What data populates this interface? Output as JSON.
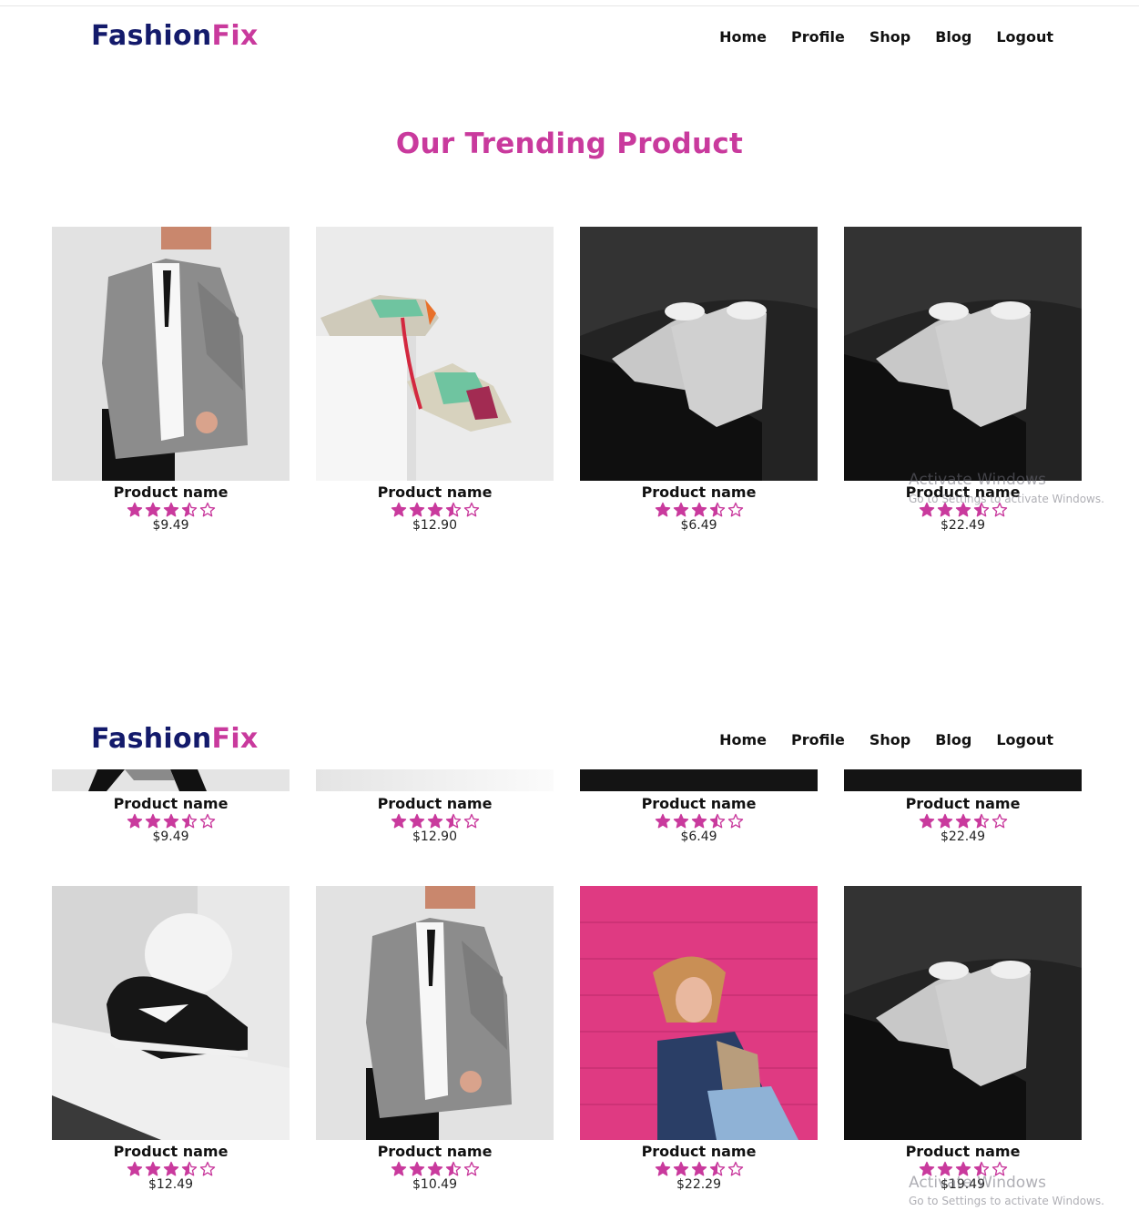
{
  "brand": {
    "part1": "Fashion",
    "part2": "Fix"
  },
  "nav": [
    "Home",
    "Profile",
    "Shop",
    "Blog",
    "Logout"
  ],
  "section_title": "Our Trending Product",
  "product_label": "Product name",
  "rating": 3.5,
  "colors": {
    "brand_navy": "#131a6b",
    "accent_pink": "#c93a9d"
  },
  "products_row1": [
    {
      "name": "Product name",
      "price": "$9.49",
      "image": "blazer-woman"
    },
    {
      "name": "Product name",
      "price": "$12.90",
      "image": "colorful-sneakers"
    },
    {
      "name": "Product name",
      "price": "$6.49",
      "image": "white-sneakers-dark"
    },
    {
      "name": "Product name",
      "price": "$22.49",
      "image": "white-sneakers-dark"
    }
  ],
  "products_row2": [
    {
      "name": "Product name",
      "price": "$12.49",
      "image": "black-nike-sneaker"
    },
    {
      "name": "Product name",
      "price": "$10.49",
      "image": "blazer-woman"
    },
    {
      "name": "Product name",
      "price": "$22.29",
      "image": "woman-pink-wall"
    },
    {
      "name": "Product name",
      "price": "$19.49",
      "image": "white-sneakers-dark"
    }
  ],
  "watermark": {
    "line1": "Activate Windows",
    "line2": "Go to Settings to activate Windows."
  }
}
